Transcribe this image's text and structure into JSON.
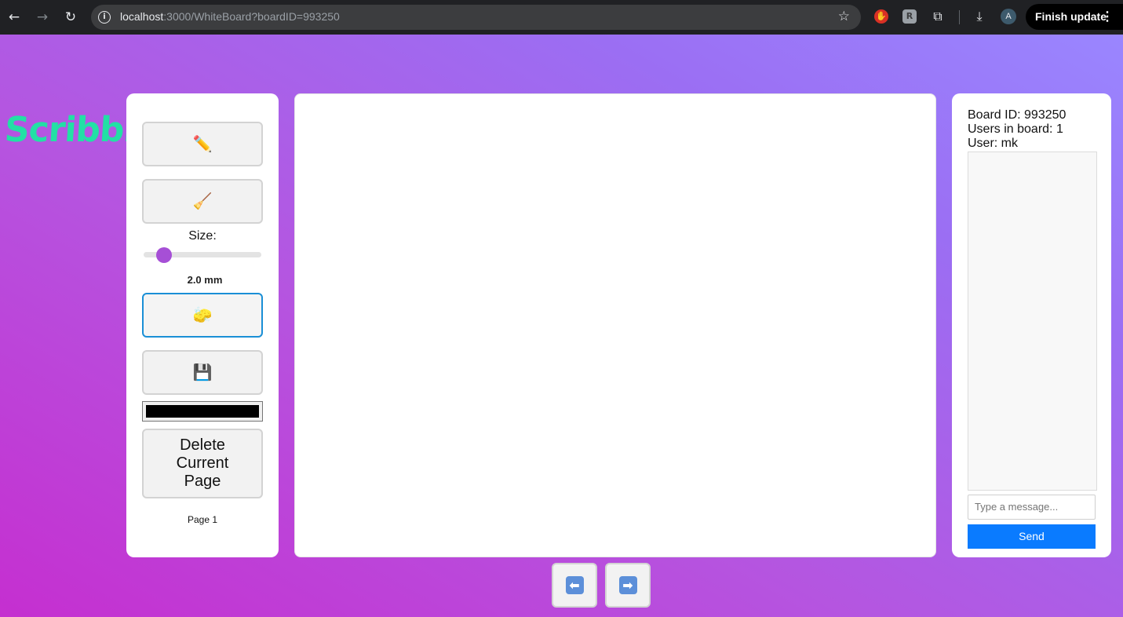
{
  "browser": {
    "url_host": "localhost",
    "url_path": ":3000/WhiteBoard?boardID=993250",
    "avatar_letter": "A",
    "finish_update_label": "Finish update",
    "icons": [
      "back-icon",
      "forward-icon",
      "reload-icon",
      "site-info-icon",
      "bookmark-star-icon",
      "extension-red-icon",
      "extension-grey-icon",
      "puzzle-icon",
      "download-icon",
      "menu-dots-icon"
    ]
  },
  "app": {
    "logo": "Scribbl"
  },
  "toolbar": {
    "tools": [
      {
        "name": "pencil",
        "icon": "✏️"
      },
      {
        "name": "broom",
        "icon": "🧹"
      },
      {
        "name": "sponge",
        "icon": "🧽",
        "active": true
      },
      {
        "name": "save",
        "icon": "💾"
      }
    ],
    "size_label": "Size:",
    "size_value": "2.0 mm",
    "size_slider_fraction": 0.12,
    "color": "#000000",
    "delete_label": "Delete Current Page",
    "page_label": "Page 1"
  },
  "chat": {
    "board_id": "Board ID: 993250",
    "users_in_board": "Users in board: 1",
    "user": "User: mk",
    "input_placeholder": "Type a message...",
    "send_label": "Send"
  },
  "pagination": {
    "prev_icon": "⬅",
    "next_icon": "➡"
  },
  "colors": {
    "logo": "#22e0a5",
    "accent": "#a64fd6",
    "send": "#0a7bff",
    "active_border": "#1a8fd6"
  }
}
